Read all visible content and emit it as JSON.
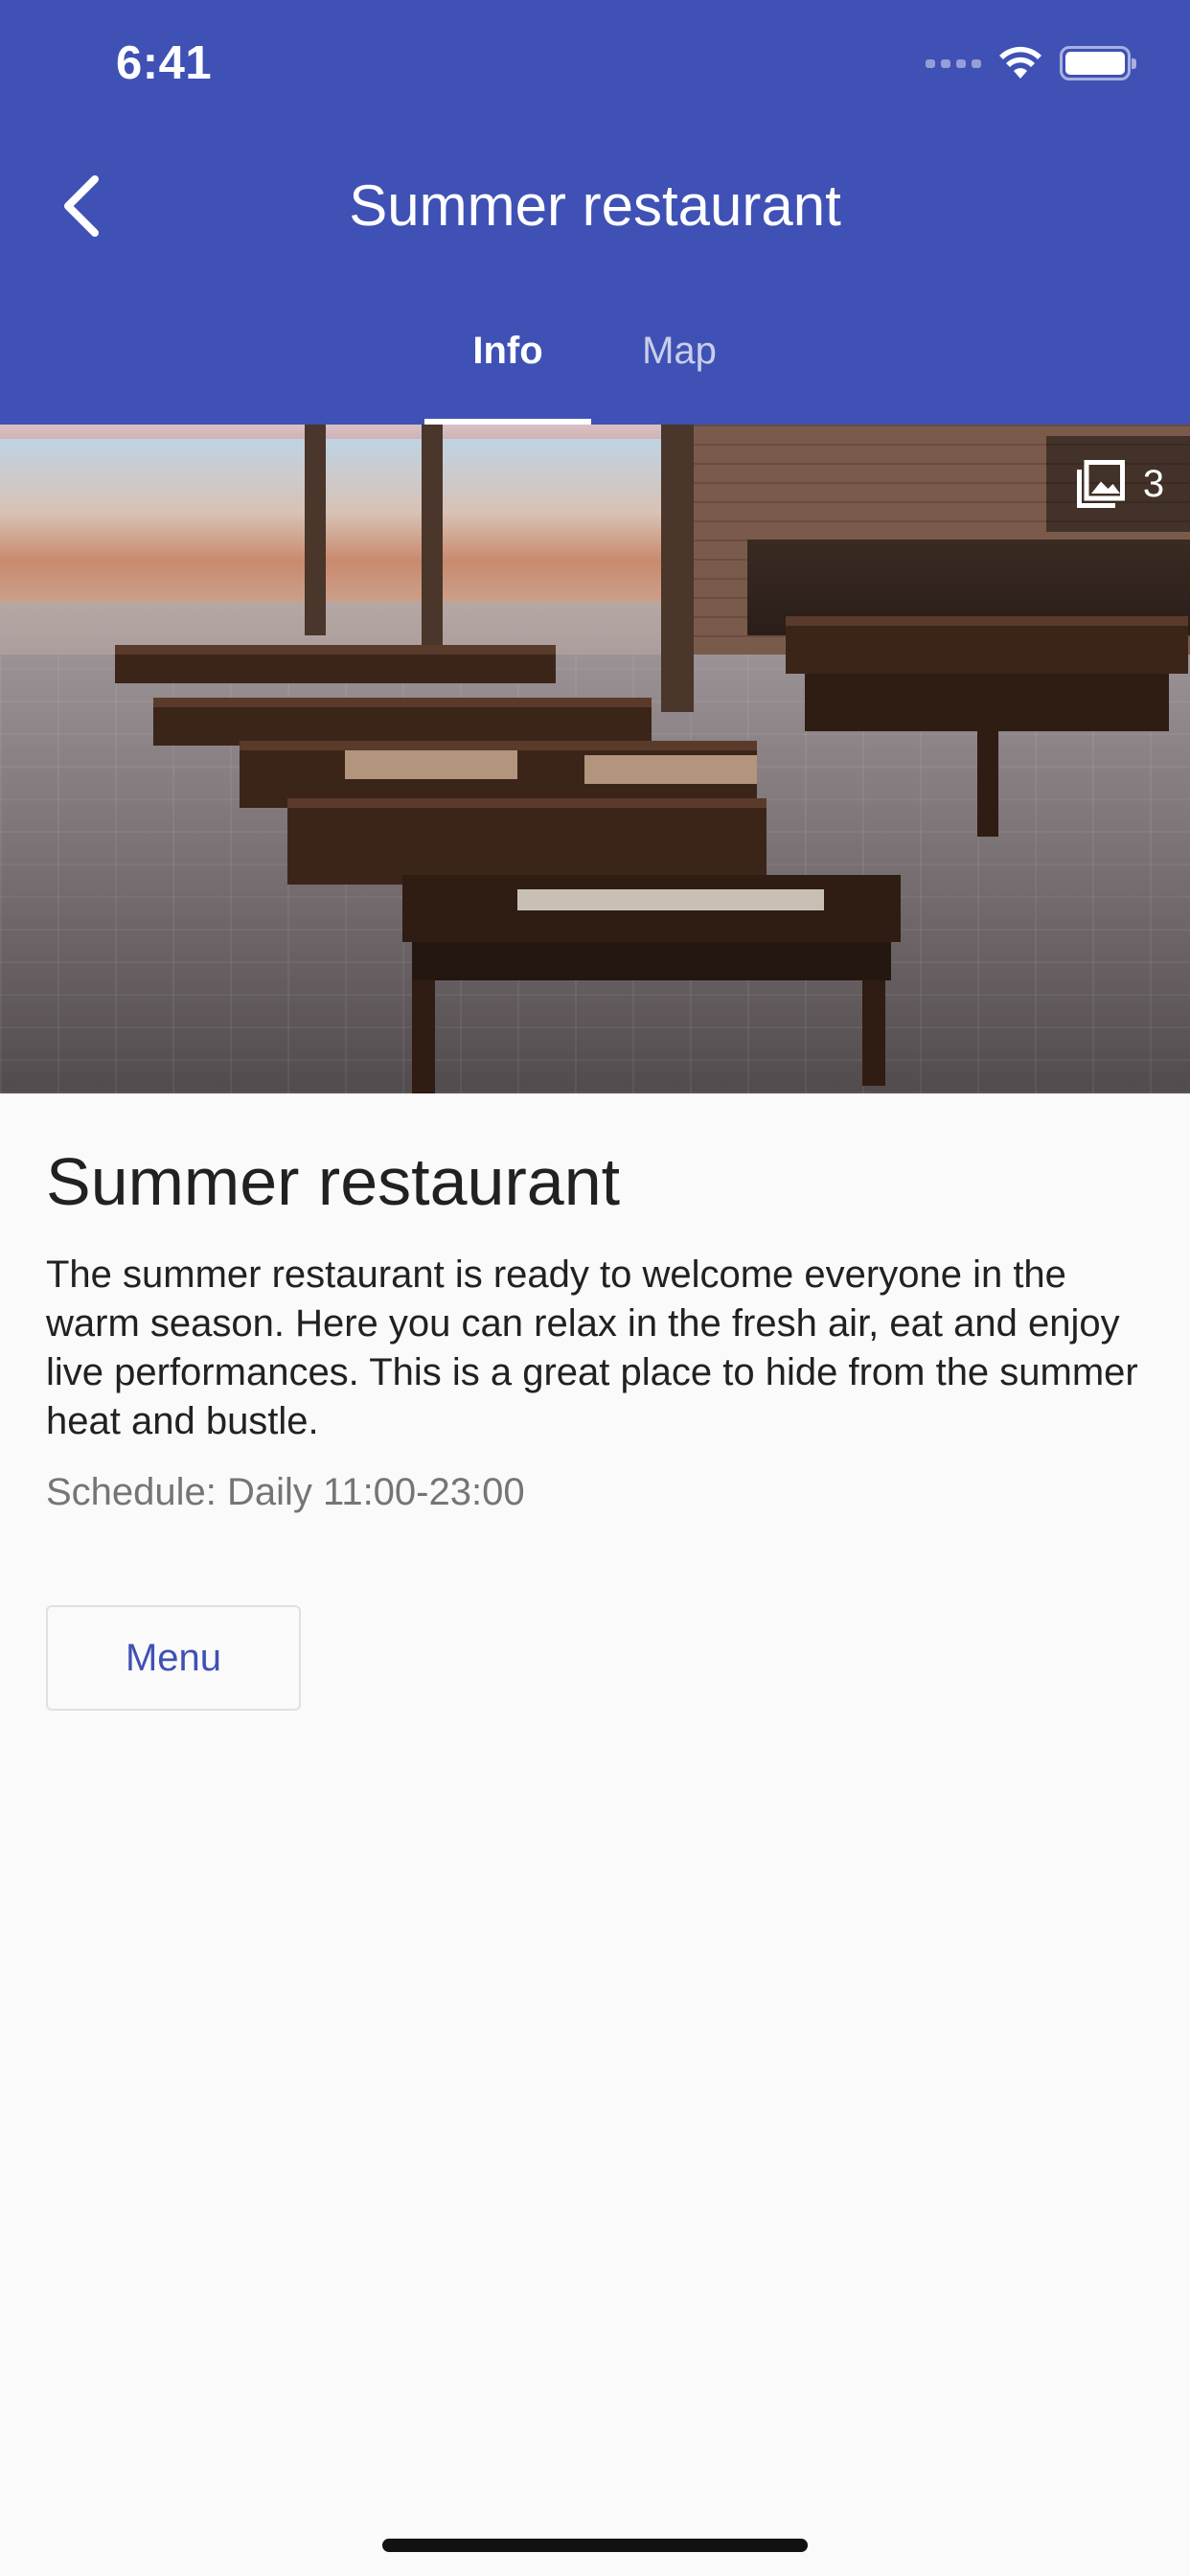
{
  "status_bar": {
    "time": "6:41",
    "icons": [
      "signal-icon",
      "wifi-icon",
      "battery-icon"
    ]
  },
  "app_bar": {
    "title": "Summer restaurant",
    "back_icon": "chevron-left-icon",
    "background_color": "#3f51b5"
  },
  "tabs": [
    {
      "label": "Info",
      "active": true
    },
    {
      "label": "Map",
      "active": false
    }
  ],
  "hero": {
    "gallery_icon": "image-icon",
    "photo_count": "3"
  },
  "venue": {
    "title": "Summer restaurant",
    "description": "The summer restaurant is ready to welcome everyone in the warm season. Here you can relax in the fresh air, eat and enjoy live performances. This is a great place to hide from the summer heat and bustle.",
    "schedule": "Schedule: Daily 11:00-23:00"
  },
  "actions": {
    "menu_label": "Menu",
    "accent_color": "#3f51b5"
  }
}
